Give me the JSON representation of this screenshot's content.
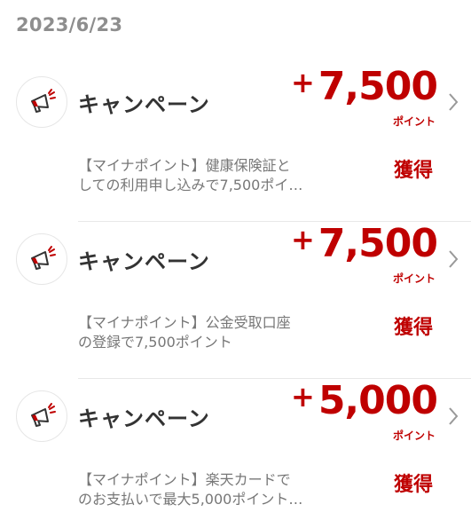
{
  "date": "2023/6/23",
  "colors": {
    "accent": "#bf0000",
    "text": "#333333",
    "muted": "#777777",
    "date": "#8e8e8e"
  },
  "items": [
    {
      "icon": "megaphone-icon",
      "title": "キャンペーン",
      "sign": "+",
      "points": "7,500",
      "unit": "ポイント",
      "status": "獲得",
      "desc_line1": "【マイナポイント】健康保険証と",
      "desc_line2": "しての利用申し込みで7,500ポイ…"
    },
    {
      "icon": "megaphone-icon",
      "title": "キャンペーン",
      "sign": "+",
      "points": "7,500",
      "unit": "ポイント",
      "status": "獲得",
      "desc_line1": "【マイナポイント】公金受取口座",
      "desc_line2": "の登録で7,500ポイント"
    },
    {
      "icon": "megaphone-icon",
      "title": "キャンペーン",
      "sign": "+",
      "points": "5,000",
      "unit": "ポイント",
      "status": "獲得",
      "desc_line1": "【マイナポイント】楽天カードで",
      "desc_line2": "のお支払いで最大5,000ポイント…"
    }
  ]
}
